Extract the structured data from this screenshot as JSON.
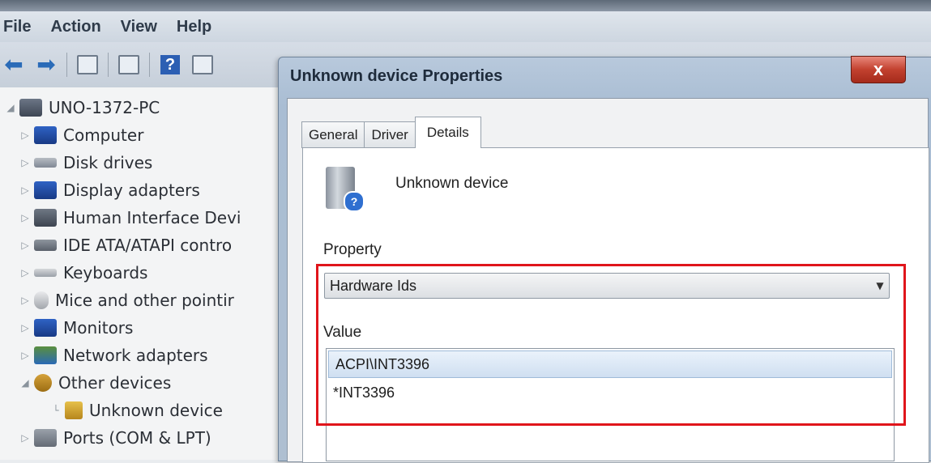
{
  "menubar": {
    "items": [
      "File",
      "Action",
      "View",
      "Help"
    ]
  },
  "toolbar": {
    "buttons": [
      "back-icon",
      "forward-icon",
      "properties-icon",
      "tree-icon",
      "help-icon",
      "view-icon"
    ]
  },
  "tree": {
    "root": "UNO-1372-PC",
    "items": [
      {
        "label": "Computer",
        "icon": "computer-icon"
      },
      {
        "label": "Disk drives",
        "icon": "disk-icon"
      },
      {
        "label": "Display adapters",
        "icon": "display-icon"
      },
      {
        "label": "Human Interface Devi",
        "icon": "hid-icon"
      },
      {
        "label": "IDE ATA/ATAPI contro",
        "icon": "ide-icon"
      },
      {
        "label": "Keyboards",
        "icon": "keyboard-icon"
      },
      {
        "label": "Mice and other pointir",
        "icon": "mouse-icon"
      },
      {
        "label": "Monitors",
        "icon": "monitor-icon"
      },
      {
        "label": "Network adapters",
        "icon": "network-icon"
      },
      {
        "label": "Other devices",
        "icon": "other-devices-icon"
      },
      {
        "label": "Unknown device",
        "icon": "unknown-device-icon"
      },
      {
        "label": "Ports (COM & LPT)",
        "icon": "port-icon"
      }
    ]
  },
  "dialog": {
    "title": "Unknown device Properties",
    "close_label": "x",
    "tabs": [
      "General",
      "Driver",
      "Details"
    ],
    "active_tab": "Details",
    "device_name": "Unknown device",
    "property_label": "Property",
    "property_value": "Hardware Ids",
    "value_label": "Value",
    "values": [
      "ACPI\\INT3396",
      "*INT3396"
    ]
  },
  "colors": {
    "highlight": "#e0151b",
    "close_button": "#c2412f"
  }
}
